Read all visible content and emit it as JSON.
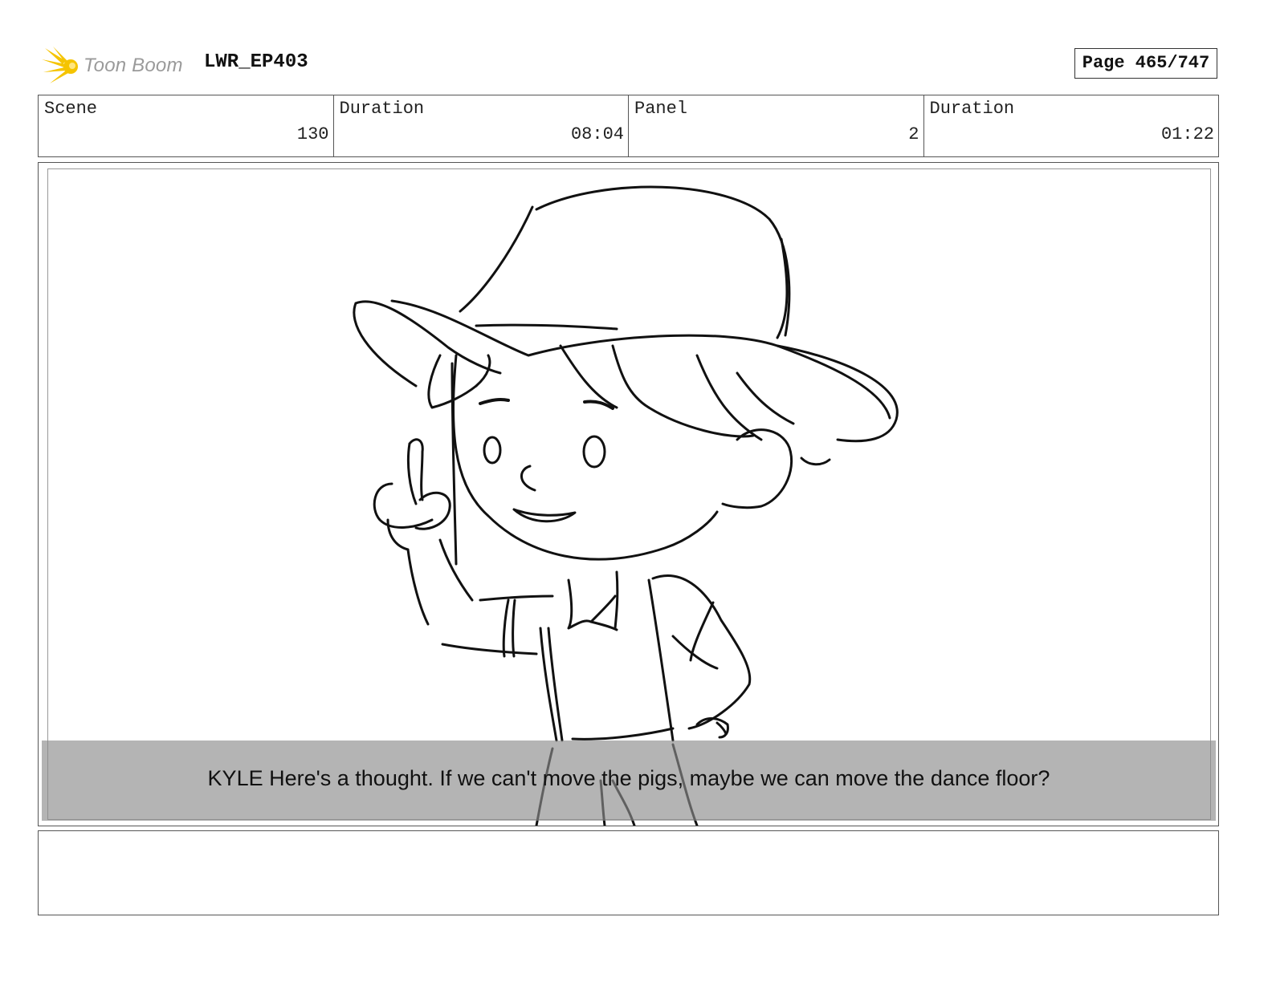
{
  "header": {
    "logo_text": "Toon Boom",
    "project": "LWR_EP403",
    "page": "Page 465/747"
  },
  "info": [
    {
      "label": "Scene",
      "value": "130"
    },
    {
      "label": "Duration",
      "value": "08:04"
    },
    {
      "label": "Panel",
      "value": "2"
    },
    {
      "label": "Duration",
      "value": "01:22"
    }
  ],
  "panel": {
    "caption": "KYLE Here's a thought. If we can't move the pigs, maybe we can move the dance floor?"
  },
  "notes": {
    "text": ""
  },
  "colors": {
    "logo_star": "#f5c400",
    "logo_text": "#9a9a9a"
  }
}
